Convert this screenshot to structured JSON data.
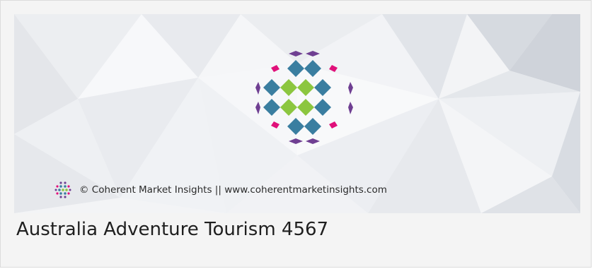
{
  "card": {
    "title": "Australia Adventure Tourism 4567"
  },
  "banner": {
    "credit_text": "© Coherent Market Insights || www.coherentmarketinsights.com",
    "logo_icon": "coherent-market-insights-logo",
    "colors": {
      "purple": "#6f3f92",
      "magenta": "#e0107a",
      "teal": "#3a7ea0",
      "green": "#8cc63f"
    }
  }
}
